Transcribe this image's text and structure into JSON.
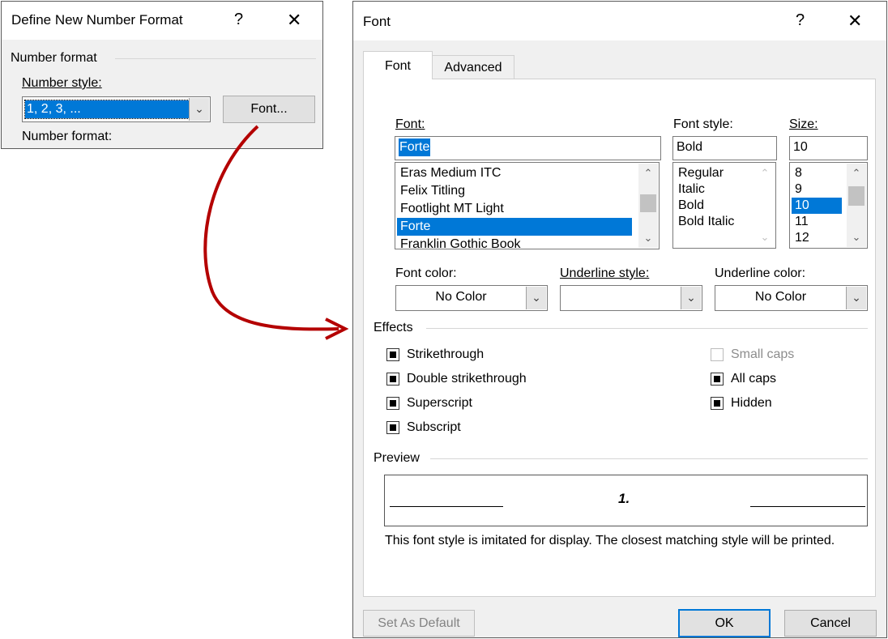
{
  "number_dialog": {
    "title": "Define New Number Format",
    "help_glyph": "?",
    "close_glyph": "✕",
    "group_label": "Number format",
    "style_label": "Number style:",
    "style_value": "1, 2, 3, ...",
    "font_button": "Font...",
    "format_label": "Number format:"
  },
  "font_dialog": {
    "title": "Font",
    "help_glyph": "?",
    "close_glyph": "✕",
    "tabs": [
      "Font",
      "Advanced"
    ],
    "font_label": "Font:",
    "font_value": "Forte",
    "font_list": [
      "Eras Medium ITC",
      "Felix Titling",
      "Footlight MT Light",
      "Forte",
      "Franklin Gothic Book"
    ],
    "font_selected": "Forte",
    "style_label": "Font style:",
    "style_value": "Bold",
    "style_list": [
      "Regular",
      "Italic",
      "Bold",
      "Bold Italic"
    ],
    "size_label": "Size:",
    "size_value": "10",
    "size_list": [
      "8",
      "9",
      "10",
      "11",
      "12"
    ],
    "size_selected": "10",
    "font_color_label": "Font color:",
    "font_color_value": "No Color",
    "underline_style_label": "Underline style:",
    "underline_style_value": "",
    "underline_color_label": "Underline color:",
    "underline_color_value": "No Color",
    "effects_label": "Effects",
    "effects": {
      "strikethrough": "Strikethrough",
      "double_strikethrough": "Double strikethrough",
      "superscript": "Superscript",
      "subscript": "Subscript",
      "small_caps": "Small caps",
      "all_caps": "All caps",
      "hidden": "Hidden"
    },
    "preview_label": "Preview",
    "preview_text": "1.",
    "note": "This font style is imitated for display. The closest matching style will be printed.",
    "buttons": {
      "set_default": "Set As Default",
      "ok": "OK",
      "cancel": "Cancel"
    }
  },
  "colors": {
    "accent": "#0078d7",
    "arrow": "#b40000"
  }
}
